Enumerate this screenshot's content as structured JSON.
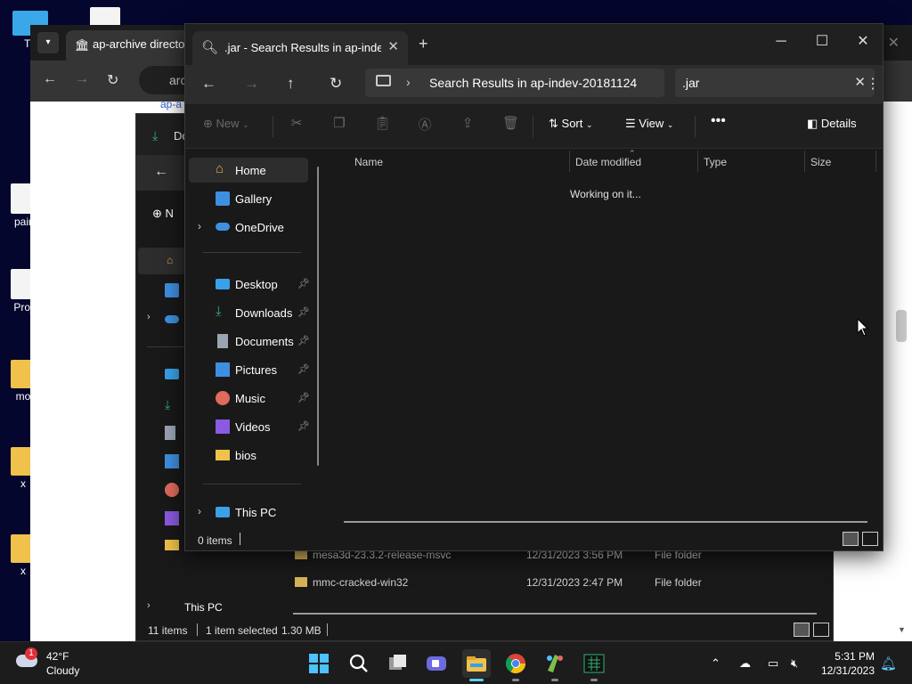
{
  "desktop": {
    "icons": [
      "Th",
      "pair",
      "Proj",
      "mo",
      "x",
      "x"
    ]
  },
  "browser": {
    "tab_title": "ap-archive directory",
    "address_text": "arc",
    "page_crumb": "ap-a"
  },
  "explorer_back": {
    "title": "Do",
    "new_label": "N",
    "rows": [
      {
        "name": "mesa3d-23.3.2-release-msvc",
        "date": "12/31/2023 3:56 PM",
        "type": "File folder"
      },
      {
        "name": "mmc-cracked-win32",
        "date": "12/31/2023 2:47 PM",
        "type": "File folder"
      }
    ],
    "this_pc": "This PC",
    "status_items": "11 items",
    "status_selected": "1 item selected",
    "status_size": "1.30 MB"
  },
  "explorer": {
    "tab_title": ".jar - Search Results in ap-inde",
    "new_tab_icon": "plus-icon",
    "address_path": "Search Results in ap-indev-20181124",
    "search_value": ".jar",
    "commands": {
      "new": "New",
      "sort": "Sort",
      "view": "View",
      "details": "Details"
    },
    "nav_items": [
      {
        "label": "Home",
        "icon": "home-icon",
        "color": "#e8a94a"
      },
      {
        "label": "Gallery",
        "icon": "gallery-icon",
        "color": "#3f8fe0"
      },
      {
        "label": "OneDrive",
        "icon": "onedrive-icon",
        "color": "#3f8fe0"
      },
      {
        "label": "Desktop",
        "icon": "desktop-icon",
        "color": "#3aa0e8"
      },
      {
        "label": "Downloads",
        "icon": "download-icon",
        "color": "#2fb36f"
      },
      {
        "label": "Documents",
        "icon": "documents-icon",
        "color": "#9aa4b3"
      },
      {
        "label": "Pictures",
        "icon": "pictures-icon",
        "color": "#3f8fe0"
      },
      {
        "label": "Music",
        "icon": "music-icon",
        "color": "#e06a5b"
      },
      {
        "label": "Videos",
        "icon": "videos-icon",
        "color": "#8a5ae0"
      },
      {
        "label": "bios",
        "icon": "folder-icon",
        "color": "#f0c14b"
      },
      {
        "label": "This PC",
        "icon": "pc-icon",
        "color": "#3aa0e8"
      }
    ],
    "columns": [
      "Name",
      "Date modified",
      "Type",
      "Size"
    ],
    "working_text": "Working on it...",
    "status_count": "0 items"
  },
  "taskbar": {
    "weather_temp": "42°F",
    "weather_cond": "Cloudy",
    "weather_badge": "1",
    "time": "5:31 PM",
    "date": "12/31/2023",
    "apps": [
      "start-icon",
      "search-icon",
      "task-view-icon",
      "meet-icon",
      "file-explorer-icon",
      "chrome-icon",
      "paint-icon",
      "terminal-icon"
    ]
  }
}
